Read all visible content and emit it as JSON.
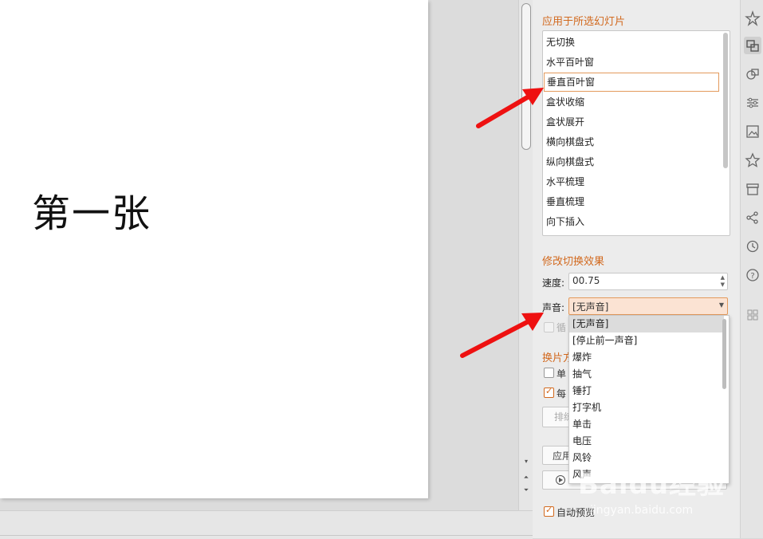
{
  "slide": {
    "text": "第一张"
  },
  "panel": {
    "apply_section_title": "应用于所选幻灯片",
    "transitions": [
      "无切换",
      "水平百叶窗",
      "垂直百叶窗",
      "盒状收缩",
      "盒状展开",
      "横向棋盘式",
      "纵向棋盘式",
      "水平梳理",
      "垂直梳理",
      "向下插入"
    ],
    "selected_transition": "垂直百叶窗",
    "modify_section_title": "修改切换效果",
    "speed_label": "速度:",
    "speed_value": "00.75",
    "sound_label": "声音:",
    "sound_value": "[无声音]",
    "sound_options": [
      "[无声音]",
      "[停止前一声音]",
      "爆炸",
      "抽气",
      "锤打",
      "打字机",
      "单击",
      "电压",
      "风铃",
      "风声"
    ],
    "loop_label_partial": "循",
    "advance_section_title_partial": "换片方",
    "on_click_label_partial": "单",
    "every_label_partial": "每",
    "sort_placeholder_partial": "排练",
    "apply_button_partial": "应用",
    "autopreview_label": "自动预览"
  },
  "watermark": {
    "brand": "Baidu经验",
    "url": "jingyan.baidu.com"
  },
  "colors": {
    "accent": "#d2691e",
    "arrow": "#ee1111"
  }
}
